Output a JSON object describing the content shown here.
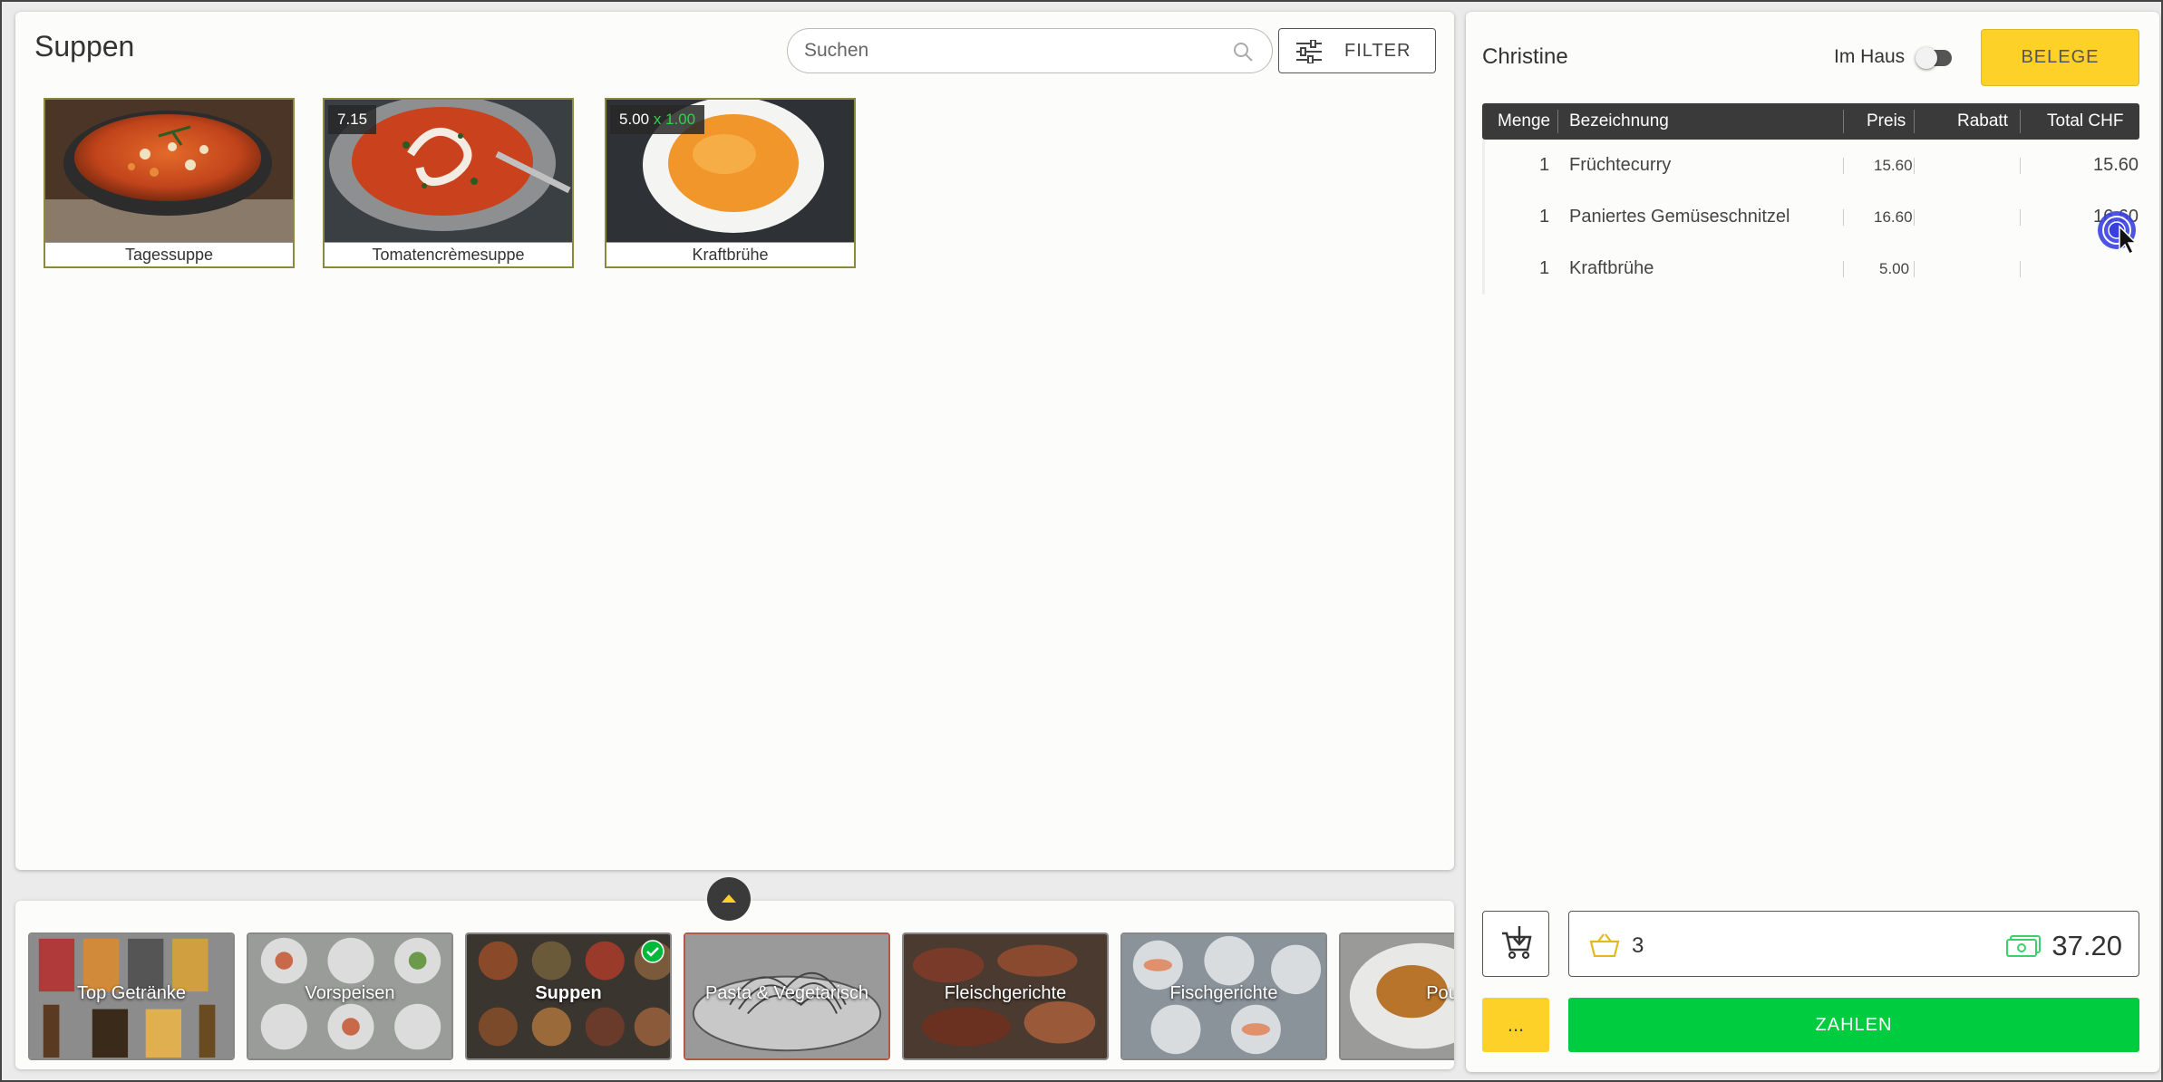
{
  "main": {
    "title": "Suppen",
    "search": {
      "placeholder": "Suchen",
      "value": ""
    },
    "filter_label": "FILTER",
    "products": [
      {
        "name": "Tagessuppe",
        "badge": null
      },
      {
        "name": "Tomatencrèmesuppe",
        "badge": "7.15"
      },
      {
        "name": "Kraftbrühe",
        "badge": "5.00",
        "badge_multiplier": "x 1.00"
      }
    ]
  },
  "categories": [
    {
      "label": "Top Getränke",
      "active": false
    },
    {
      "label": "Vorspeisen",
      "active": false
    },
    {
      "label": "Suppen",
      "active": true
    },
    {
      "label": "Pasta & Vegetarisch",
      "active": false
    },
    {
      "label": "Fleischgerichte",
      "active": false
    },
    {
      "label": "Fischgerichte",
      "active": false
    },
    {
      "label": "Pou",
      "active": false
    }
  ],
  "order": {
    "customer": "Christine",
    "im_haus_label": "Im Haus",
    "im_haus_on": false,
    "belege_label": "BELEGE",
    "columns": [
      "Menge",
      "Bezeichnung",
      "Preis",
      "Rabatt",
      "Total CHF"
    ],
    "rows": [
      {
        "qty": "1",
        "name": "Früchtecurry",
        "price": "15.60",
        "discount": "",
        "total": "15.60"
      },
      {
        "qty": "1",
        "name": "Paniertes Gemüseschnitzel",
        "price": "16.60",
        "discount": "",
        "total": "16.60"
      },
      {
        "qty": "1",
        "name": "Kraftbrühe",
        "price": "5.00",
        "discount": "",
        "total": ""
      }
    ],
    "item_count": "3",
    "total": "37.20",
    "more_label": "...",
    "pay_label": "ZAHLEN"
  },
  "colors": {
    "accent_yellow": "#fdd128",
    "pay_green": "#00cc3f",
    "header_dark": "#3a3a3a",
    "card_border": "#8a8a3c"
  }
}
